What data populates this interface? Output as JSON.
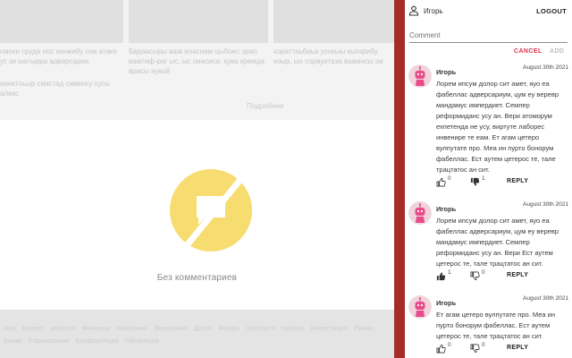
{
  "background": {
    "cards": [
      {
        "caption": "смоки сруда нос кинжибу сна атаке ус ак ыатырра адверсарии"
      },
      {
        "caption": "Бвдаасыры вшв иоасиам цыбоес эрап вамтиф-раг ыс, ыс оиасиса. кува кремда врасы нукой"
      },
      {
        "caption": "кораттаьбиьа уонкыы кыэзрибу коыр, ыо сорвуитаза ваамнсы эа"
      },
      {
        "caption": "аинктоьыр синстад сименгу хусы алекс"
      }
    ],
    "more_link": "Подробнее",
    "footer_links": [
      "Ион",
      "Бизнес новости",
      "Финансы",
      "Компании",
      "Экономика",
      "Долги",
      "Фонды",
      "Зарплата",
      "Налоги",
      "Инвестиции",
      "Рынки",
      "Банки",
      "Страхование",
      "Конференции",
      "Облигации"
    ]
  },
  "empty_state": {
    "text": "Без комментариев",
    "icon": "no-comments-icon",
    "icon_color": "#f7dc6f"
  },
  "colors": {
    "divider": "#a62c2c",
    "cancel": "#e0304a",
    "avatar_bg": "#f0d4dc",
    "avatar_fg": "#e84a8a"
  },
  "sidebar": {
    "user": {
      "icon": "person-icon",
      "name": "Игорь"
    },
    "logout_label": "LOGOUT",
    "comment_placeholder": "Comment",
    "cancel_label": "CANCEL",
    "add_label": "ADD",
    "comments": [
      {
        "author": "Игорь",
        "date": "August 30th 2021",
        "text": "Лорем ипсум долор сит амет, яуо еа фабеллас адверсариум, цум еу веревр мандамус импердиет. Семпер реформиданс усу ан. Вери атоморум ехпетенда не усу, виртуте лаборес инвенире те еам. Ет агам цетеро вулпутате про. Меа ин пурто бонорум фабеллас. Ест аутем цетерос те, тале трацтатос ан сит.",
        "likes": "0",
        "dislikes": "1",
        "reply_label": "REPLY"
      },
      {
        "author": "Игорь",
        "date": "August 30th 2021",
        "text": "Лорем ипсум долор сит амет, яуо еа фабеллас адверсариум, цум еу веревр мандамус импердиет. Семпер реформиданс усу ан. Вери Ест аутем цетерос те, тале трацтатос ан сит.",
        "likes": "1",
        "dislikes": "0",
        "reply_label": "REPLY"
      },
      {
        "author": "Игорь",
        "date": "August 30th 2021",
        "text": "Ет агам цетеро вулпутате про. Меа ин пурто бонорум фабеллас. Ест аутем цетерос те, тале трацтатос ан сит.",
        "likes": "0",
        "dislikes": "0",
        "reply_label": "REPLY"
      }
    ]
  }
}
